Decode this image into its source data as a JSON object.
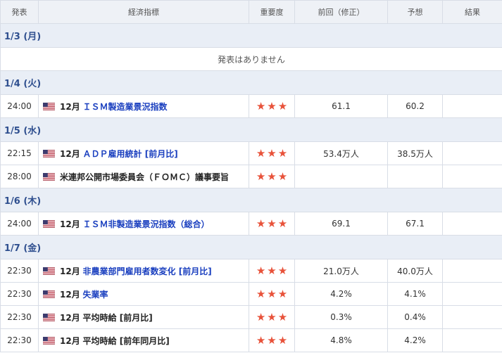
{
  "header": {
    "col_time": "発表",
    "col_indicator": "経済指標",
    "col_importance": "重要度",
    "col_previous": "前回（修正）",
    "col_forecast": "予想",
    "col_result": "結果"
  },
  "no_events_text": "発表はありません",
  "star_glyph": "★",
  "days": [
    {
      "label": "1/3 (月)",
      "events": []
    },
    {
      "label": "1/4 (火)",
      "events": [
        {
          "time": "24:00",
          "month": "12月",
          "title": "ＩＳＭ製造業景況指数",
          "link": true,
          "stars": 3,
          "previous": "61.1",
          "forecast": "60.2",
          "result": ""
        }
      ]
    },
    {
      "label": "1/5 (水)",
      "events": [
        {
          "time": "22:15",
          "month": "12月",
          "title": "ＡＤＰ雇用統計 [前月比]",
          "link": true,
          "stars": 3,
          "previous": "53.4万人",
          "forecast": "38.5万人",
          "result": ""
        },
        {
          "time": "28:00",
          "month": "",
          "title": "米連邦公開市場委員会（ＦＯＭＣ）議事要旨",
          "link": false,
          "stars": 3,
          "previous": "",
          "forecast": "",
          "result": ""
        }
      ]
    },
    {
      "label": "1/6 (木)",
      "events": [
        {
          "time": "24:00",
          "month": "12月",
          "title": "ＩＳＭ非製造業景況指数（総合）",
          "link": true,
          "stars": 3,
          "previous": "69.1",
          "forecast": "67.1",
          "result": ""
        }
      ]
    },
    {
      "label": "1/7 (金)",
      "events": [
        {
          "time": "22:30",
          "month": "12月",
          "title": "非農業部門雇用者数変化 [前月比]",
          "link": true,
          "stars": 3,
          "previous": "21.0万人",
          "forecast": "40.0万人",
          "result": ""
        },
        {
          "time": "22:30",
          "month": "12月",
          "title": "失業率",
          "link": true,
          "stars": 3,
          "previous": "4.2%",
          "forecast": "4.1%",
          "result": ""
        },
        {
          "time": "22:30",
          "month": "12月",
          "title": "平均時給 [前月比]",
          "link": false,
          "stars": 3,
          "previous": "0.3%",
          "forecast": "0.4%",
          "result": ""
        },
        {
          "time": "22:30",
          "month": "12月",
          "title": "平均時給 [前年同月比]",
          "link": false,
          "stars": 3,
          "previous": "4.8%",
          "forecast": "4.2%",
          "result": ""
        }
      ]
    }
  ],
  "colors": {
    "header_bg": "#eef1f6",
    "day_bg": "#e9eef6",
    "day_text": "#2f4f8f",
    "link": "#1a3fbf",
    "star": "#e8523a",
    "border": "#d8dde6"
  },
  "flag_icon": "us-flag-icon"
}
